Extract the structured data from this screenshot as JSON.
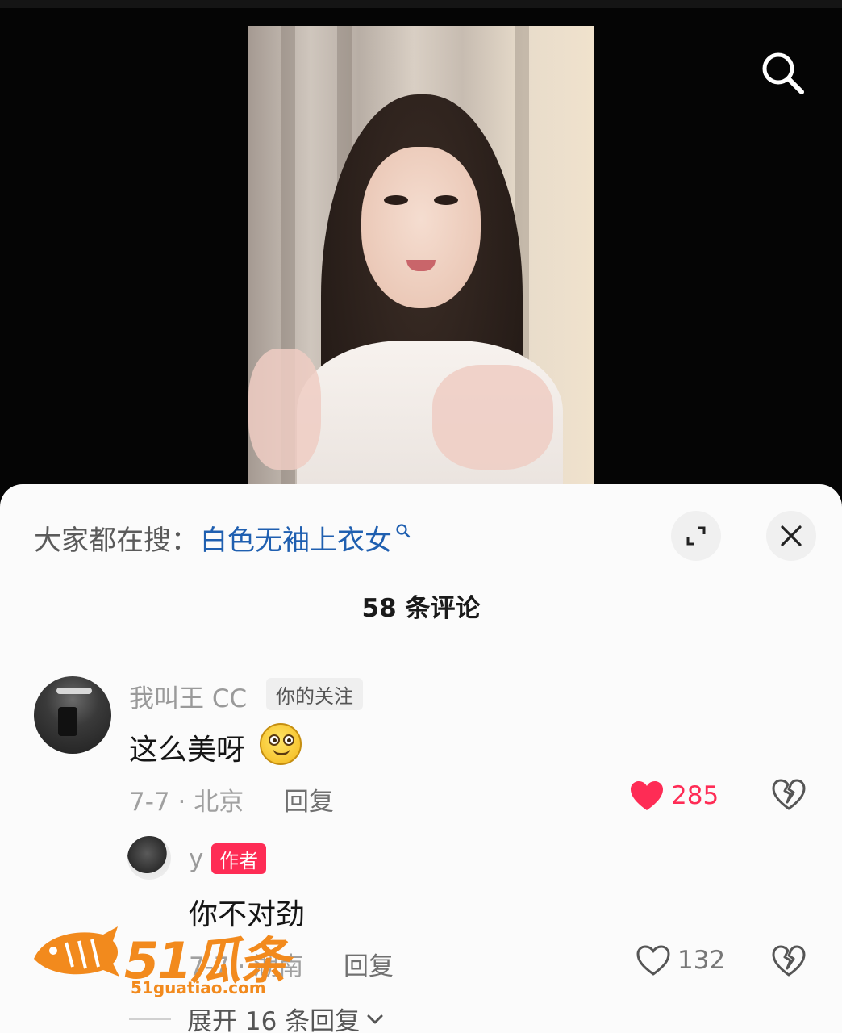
{
  "search": {
    "label": "大家都在搜：",
    "term": "白色无袖上衣女"
  },
  "header": {
    "comment_count": "58 条评论"
  },
  "comments": [
    {
      "username": "我叫王 CC",
      "tag": "你的关注",
      "text": "这么美呀",
      "meta": "7-7 · 北京",
      "reply_label": "回复",
      "likes": "285",
      "liked": true
    }
  ],
  "replies": [
    {
      "username": "y",
      "tag": "作者",
      "text": "你不对劲",
      "meta": "7-7 · 湖南",
      "reply_label": "回复",
      "likes": "132",
      "liked": false
    }
  ],
  "expand": {
    "label": "展开 16 条回复"
  },
  "watermark": {
    "text": "51瓜条",
    "url": "51guatiao.com"
  },
  "colors": {
    "accent_red": "#fe2c55",
    "search_link": "#1f5fb0",
    "watermark_orange": "#f28a1d"
  }
}
